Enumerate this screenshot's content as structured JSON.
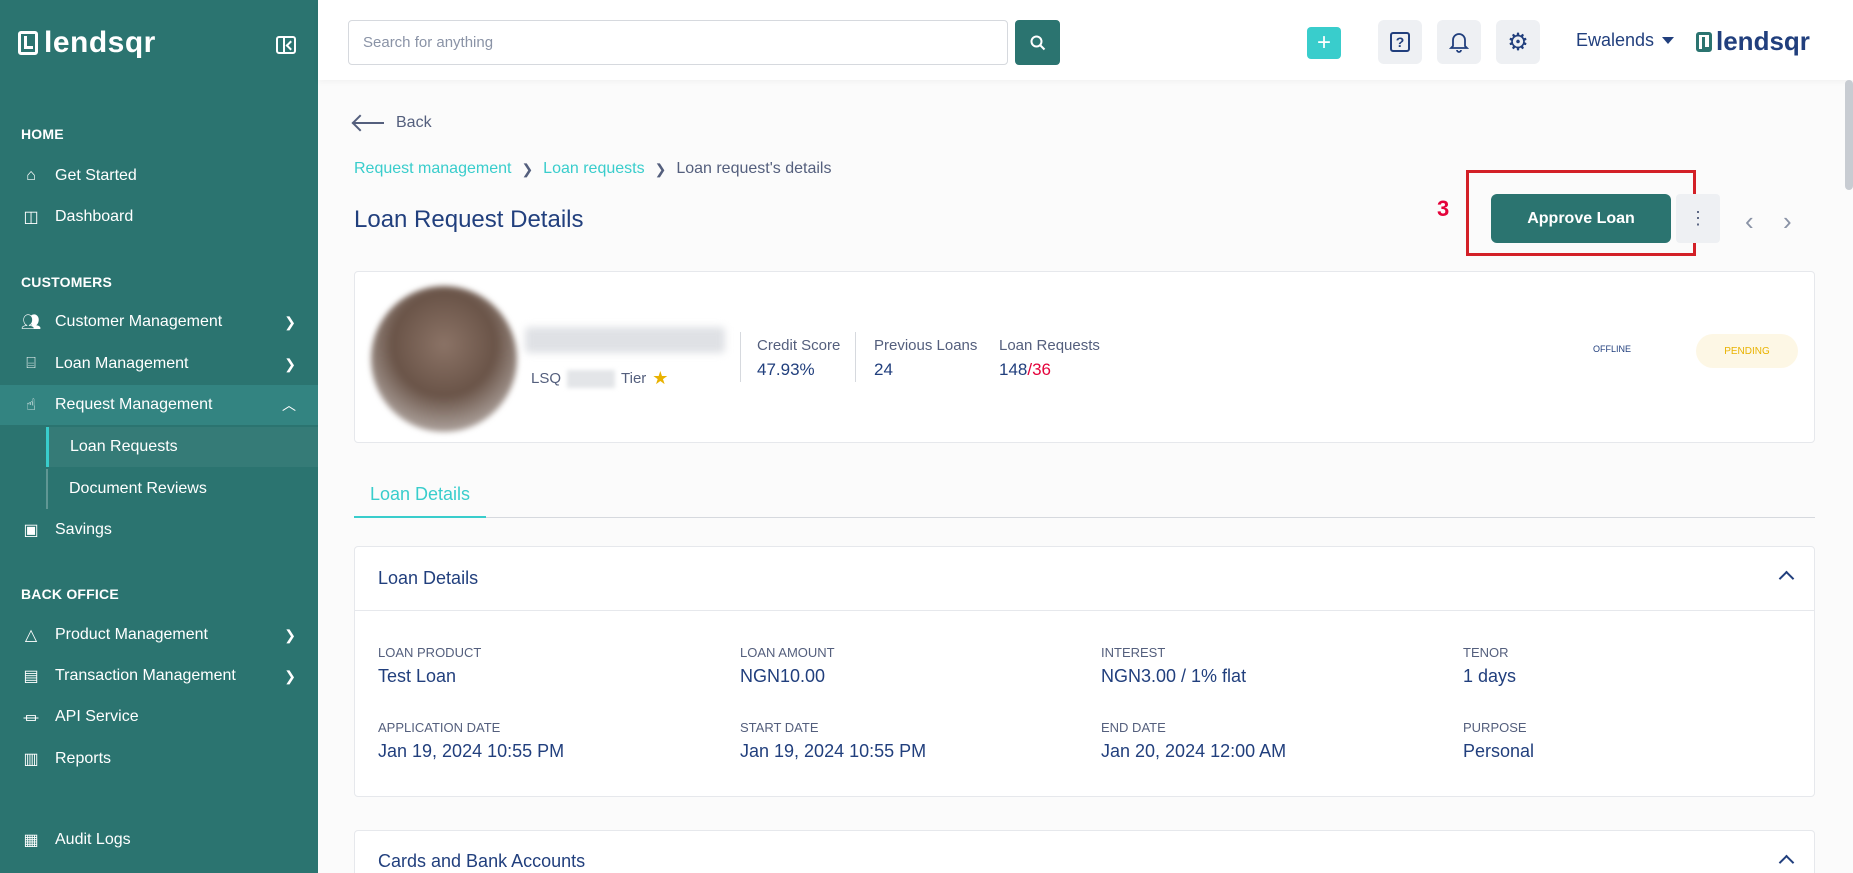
{
  "sidebar": {
    "logo_text": "lendsqr",
    "sections": {
      "home": "HOME",
      "customers": "CUSTOMERS",
      "back_office": "BACK OFFICE"
    },
    "items": {
      "get_started": "Get Started",
      "dashboard": "Dashboard",
      "customer_management": "Customer Management",
      "loan_management": "Loan Management",
      "request_management": "Request Management",
      "loan_requests": "Loan Requests",
      "document_reviews": "Document Reviews",
      "savings": "Savings",
      "product_management": "Product Management",
      "transaction_management": "Transaction Management",
      "api_service": "API Service",
      "reports": "Reports",
      "audit_logs": "Audit Logs"
    }
  },
  "topbar": {
    "search_placeholder": "Search for anything",
    "user_name": "Ewalends",
    "brand_text": "lendsqr"
  },
  "page": {
    "back_label": "Back",
    "breadcrumb": [
      "Request management",
      "Loan requests",
      "Loan request's details"
    ],
    "title": "Loan Request Details",
    "annotation_number": "3",
    "approve_label": "Approve Loan"
  },
  "profile": {
    "lsq_prefix": "LSQ",
    "tier_label": "Tier",
    "credit_score_label": "Credit Score",
    "credit_score_value": "47.93%",
    "previous_loans_label": "Previous Loans",
    "previous_loans_value": "24",
    "loan_requests_label": "Loan Requests",
    "loan_requests_value": "148",
    "loan_requests_total": "/36",
    "status_offline": "OFFLINE",
    "status_pending": "PENDING"
  },
  "tabs": [
    "Loan Details"
  ],
  "loan_details": {
    "title": "Loan Details",
    "fields": [
      {
        "label": "LOAN PRODUCT",
        "value": "Test Loan"
      },
      {
        "label": "LOAN AMOUNT",
        "value": "NGN10.00"
      },
      {
        "label": "INTEREST",
        "value": "NGN3.00 / 1% flat"
      },
      {
        "label": "TENOR",
        "value": "1 days"
      },
      {
        "label": "APPLICATION DATE",
        "value": "Jan 19, 2024 10:55 PM"
      },
      {
        "label": "START DATE",
        "value": "Jan 19, 2024 10:55 PM"
      },
      {
        "label": "END DATE",
        "value": "Jan 20, 2024 12:00 AM"
      },
      {
        "label": "PURPOSE",
        "value": "Personal"
      }
    ]
  },
  "cards_section": {
    "title": "Cards and Bank Accounts"
  },
  "colors": {
    "sidebar": "#2b7470",
    "accent": "#39cdcc",
    "text": "#213f7d",
    "annotation_red": "#d32027"
  }
}
